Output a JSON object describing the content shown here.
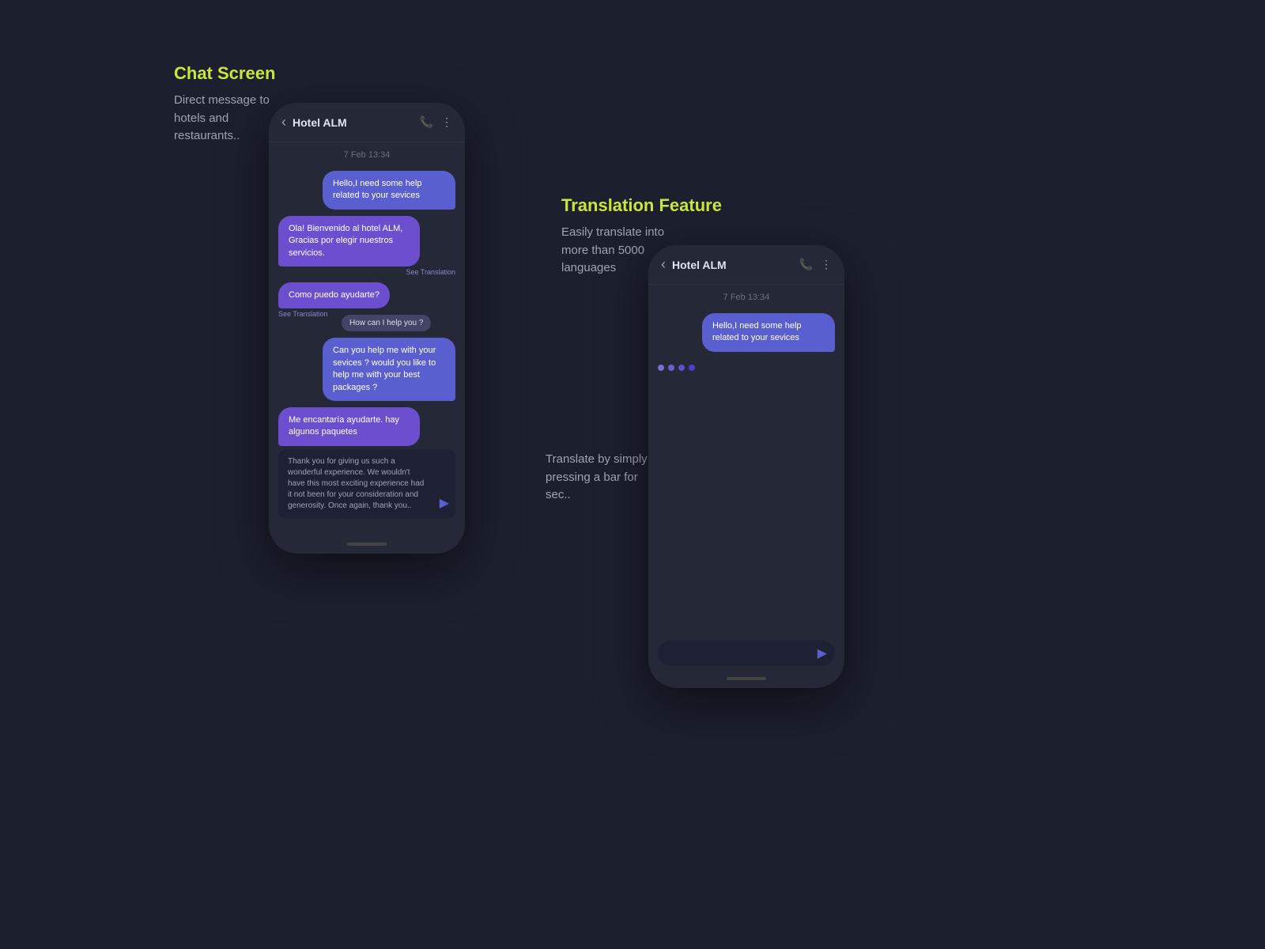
{
  "left_section": {
    "title": "Chat Screen",
    "description": "Direct message to hotels and restaurants.."
  },
  "right_section": {
    "title": "Translation Feature",
    "description": "Easily translate into more than 5000 languages",
    "description2": "Translate by simply pressing a bar for sec.."
  },
  "chat_left": {
    "hotel_name": "Hotel ALM",
    "timestamp": "7 Feb 13:34",
    "messages": [
      {
        "type": "sent",
        "text": "Hello,I need some help related to your sevices"
      },
      {
        "type": "received",
        "text": "Ola! Bienvenido al hotel ALM, Gracias por elegir nuestros servicios."
      },
      {
        "type": "received_spanish",
        "text": "Como puedo ayudarte?"
      },
      {
        "type": "tooltip",
        "text": "How can I help you ?"
      },
      {
        "type": "sent",
        "text": "Can you help me with your sevices ? would you like to help me with your best packages ?"
      },
      {
        "type": "received",
        "text": "Me encantaría ayudarte. hay algunos paquetes"
      },
      {
        "type": "typing",
        "text": "Thank you for giving us such a wonderful experience. We wouldn't have this most exciting experience had it not been for your consideration and generosity. Once again, thank you.."
      }
    ],
    "see_translation": "See Translation",
    "see_translation2": "See Translation"
  },
  "chat_right": {
    "hotel_name": "Hotel ALM",
    "timestamp": "7 Feb 13:34",
    "messages": [
      {
        "type": "sent",
        "text": "Hello,I need some help related to your sevices"
      }
    ]
  },
  "icons": {
    "back": "‹",
    "phone": "📞",
    "more": "⋮",
    "send": "▶"
  }
}
